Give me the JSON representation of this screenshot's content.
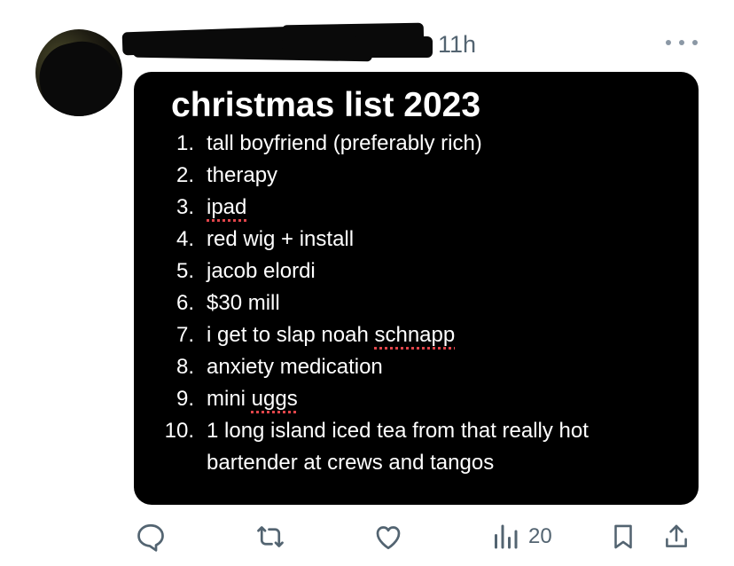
{
  "tweet": {
    "timestamp": "11h",
    "more_icon": "ellipsis-icon"
  },
  "note": {
    "title": "christmas list 2023",
    "items": [
      {
        "num": "1.",
        "text": "tall boyfriend (preferably rich)"
      },
      {
        "num": "2.",
        "text": "therapy"
      },
      {
        "num": "3.",
        "text": "ipad"
      },
      {
        "num": "4.",
        "text": "red wig + install"
      },
      {
        "num": "5.",
        "text": "jacob elordi"
      },
      {
        "num": "6.",
        "text": "$30 mill"
      },
      {
        "num": "7.",
        "text_before": "i get to slap noah ",
        "text_flagged": "schnapp"
      },
      {
        "num": "8.",
        "text": "anxiety medication"
      },
      {
        "num": "9.",
        "text_before": "mini ",
        "text_flagged": "uggs"
      },
      {
        "num": "10.",
        "text": "1 long island iced tea from that really hot bartender at crews and tangos"
      }
    ]
  },
  "actions": {
    "reply_icon": "reply-icon",
    "retweet_icon": "retweet-icon",
    "like_icon": "heart-icon",
    "views_icon": "bar-chart-icon",
    "views_count": "20",
    "bookmark_icon": "bookmark-icon",
    "share_icon": "share-icon"
  },
  "colors": {
    "muted": "#536471",
    "spellcheck": "#e0454a",
    "media_bg": "#000000"
  }
}
